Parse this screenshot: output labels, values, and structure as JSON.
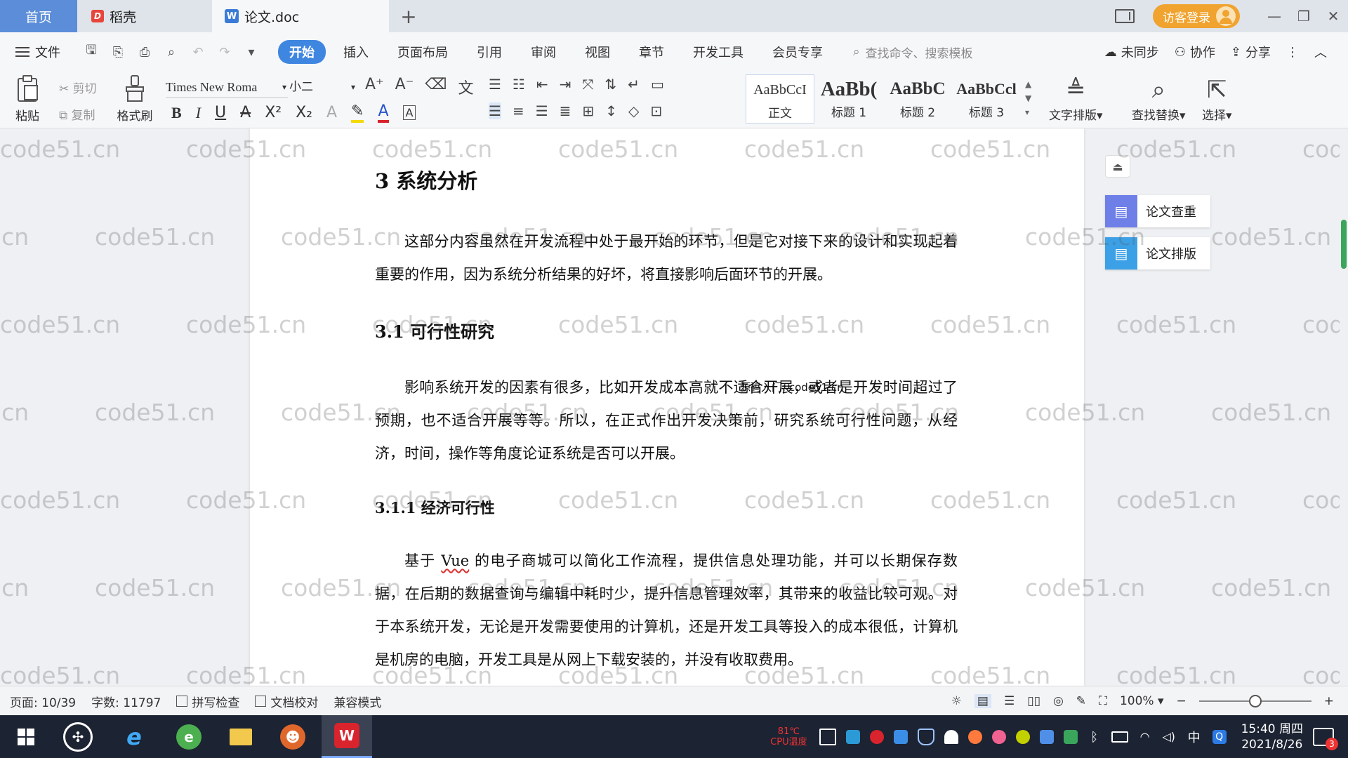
{
  "titlebar": {
    "tabs": [
      {
        "label": "首页"
      },
      {
        "label": "稻壳"
      },
      {
        "label": "论文.doc"
      }
    ],
    "login_label": "访客登录"
  },
  "menu": {
    "file_label": "文件",
    "tabs": [
      "开始",
      "插入",
      "页面布局",
      "引用",
      "审阅",
      "视图",
      "章节",
      "开发工具",
      "会员专享"
    ],
    "search_placeholder": "查找命令、搜索模板",
    "sync_label": "未同步",
    "collab_label": "协作",
    "share_label": "分享"
  },
  "ribbon": {
    "paste_label": "粘贴",
    "cut_label": "剪切",
    "copy_label": "复制",
    "painter_label": "格式刷",
    "font_name": "Times New Roma",
    "font_size": "小二",
    "styles": [
      {
        "preview": "AaBbCcI",
        "name": "正文"
      },
      {
        "preview": "AaBb(",
        "name": "标题 1"
      },
      {
        "preview": "AaBbC",
        "name": "标题 2"
      },
      {
        "preview": "AaBbCcl",
        "name": "标题 3"
      }
    ],
    "text_layout_label": "文字排版",
    "find_replace_label": "查找替换",
    "select_label": "选择"
  },
  "document": {
    "h1": "3  系统分析",
    "p1": "这部分内容虽然在开发流程中处于最开始的环节，但是它对接下来的设计和实现起着重要的作用，因为系统分析结果的好坏，将直接影响后面环节的开展。",
    "h2_1": "3.1 可行性研究",
    "p2": "影响系统开发的因素有很多，比如开发成本高就不适合开展，或者是开发时间超过了预期，也不适合开展等等。所以，在正式作出开发决策前，研究系统可行性问题，从经济，时间，操作等角度论证系统是否可以开展。",
    "overlay_text": "源码入门: code51.cn",
    "h3_1": "3.1.1 经济可行性",
    "p3_before": "基于 ",
    "p3_spell": "Vue",
    "p3_after": " 的电子商城可以简化工作流程，提供信息处理功能，并可以长期保存数据，在后期的数据查询与编辑中耗时少，提升信息管理效率，其带来的收益比较可观。对于本系统开发，无论是开发需要使用的计算机，还是开发工具等投入的成本很低，计算机是机房的电脑，开发工具是从网上下载安装的，并没有收取费用。"
  },
  "side_panel": {
    "check_label": "论文查重",
    "layout_label": "论文排版",
    "check_color": "#6e7fe8",
    "layout_color": "#3ba0e6"
  },
  "watermark": "code51.cn",
  "statusbar": {
    "page": "页面: 10/39",
    "words": "字数: 11797",
    "spell": "拼写检查",
    "proof": "文档校对",
    "compat": "兼容模式",
    "zoom": "100%",
    "zoom_level": 0.5
  },
  "taskbar": {
    "temp_label": "81℃",
    "cpu_label": "CPU温度",
    "time": "15:40 周四",
    "date": "2021/8/26",
    "ime": "中",
    "notif_count": "3"
  }
}
